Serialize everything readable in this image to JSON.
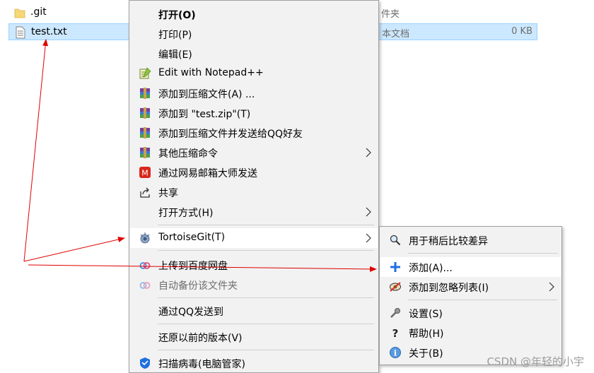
{
  "files": [
    {
      "name": ".git",
      "type": "件夹",
      "size": ""
    },
    {
      "name": "test.txt",
      "type": "本文档",
      "size": "0 KB"
    }
  ],
  "context_menu": {
    "items": [
      {
        "label": "打开(O)",
        "icon": ""
      },
      {
        "label": "打印(P)",
        "icon": ""
      },
      {
        "label": "编辑(E)",
        "icon": ""
      },
      {
        "label": "Edit with Notepad++",
        "icon": "notepad-plus-plus-icon"
      },
      {
        "label": "添加到压缩文件(A) ...",
        "icon": "winrar-icon"
      },
      {
        "label": "添加到 \"test.zip\"(T)",
        "icon": "winrar-icon"
      },
      {
        "label": "添加到压缩文件并发送给QQ好友",
        "icon": "winrar-icon"
      },
      {
        "label": "其他压缩命令",
        "icon": "winrar-icon"
      },
      {
        "label": "通过网易邮箱大师发送",
        "icon": "netease-mail-icon"
      },
      {
        "label": "共享",
        "icon": "share-icon"
      },
      {
        "label": "打开方式(H)",
        "icon": ""
      },
      {
        "label": "TortoiseGit(T)",
        "icon": "tortoisegit-icon"
      },
      {
        "label": "上传到百度网盘",
        "icon": "baidu-netdisk-icon"
      },
      {
        "label": "自动备份该文件夹",
        "icon": "baidu-netdisk-icon"
      },
      {
        "label": "通过QQ发送到",
        "icon": ""
      },
      {
        "label": "还原以前的版本(V)",
        "icon": ""
      },
      {
        "label": "扫描病毒(电脑管家)",
        "icon": "pc-manager-shield-icon"
      }
    ]
  },
  "submenu": {
    "items": [
      {
        "label": "用于稍后比较差异",
        "icon": "magnifier-icon"
      },
      {
        "label": "添加(A)...",
        "icon": "plus-icon"
      },
      {
        "label": "添加到忽略列表(I)",
        "icon": "ignore-icon"
      },
      {
        "label": "设置(S)",
        "icon": "wrench-icon"
      },
      {
        "label": "帮助(H)",
        "icon": "help-icon"
      },
      {
        "label": "关于(B)",
        "icon": "info-icon"
      }
    ]
  },
  "watermark": "CSDN @年轻的小宇",
  "colors": {
    "selection": "#cce8ff",
    "menu_bg": "#f2f2f2",
    "annotation": "#e00000"
  }
}
